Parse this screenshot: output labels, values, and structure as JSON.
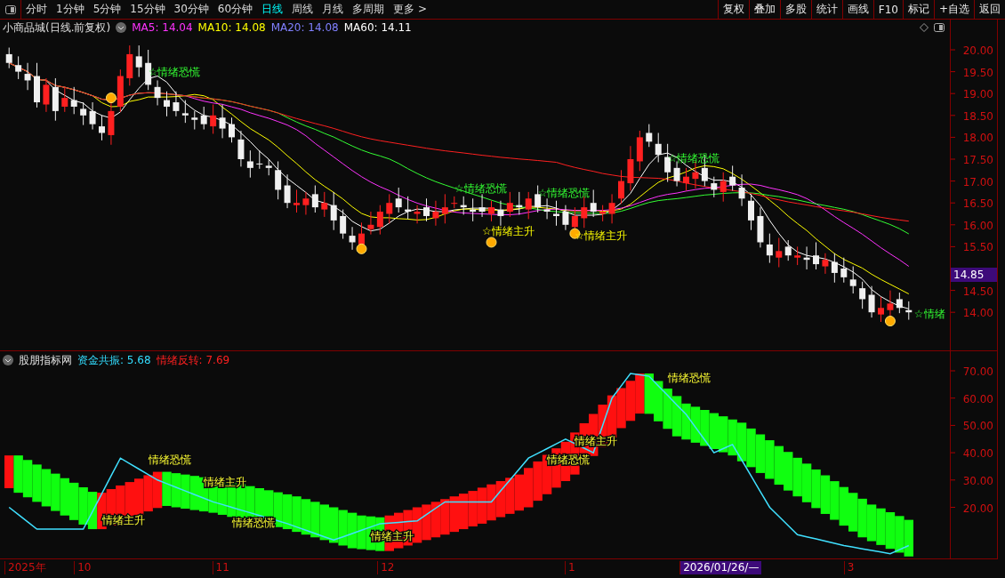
{
  "toolbar": {
    "periods": [
      {
        "label": "分时",
        "selected": false
      },
      {
        "label": "1分钟",
        "selected": false
      },
      {
        "label": "5分钟",
        "selected": false
      },
      {
        "label": "15分钟",
        "selected": false
      },
      {
        "label": "30分钟",
        "selected": false
      },
      {
        "label": "60分钟",
        "selected": false
      },
      {
        "label": "日线",
        "selected": true
      },
      {
        "label": "周线",
        "selected": false
      },
      {
        "label": "月线",
        "selected": false
      },
      {
        "label": "多周期",
        "selected": false
      },
      {
        "label": "更多 >",
        "selected": false
      }
    ],
    "buttons": [
      "复权",
      "叠加",
      "多股",
      "统计",
      "画线",
      "F10",
      "标记",
      "+自选",
      "返回"
    ]
  },
  "price_pane": {
    "title": "小商品城(日线.前复权)",
    "indicators": [
      {
        "text": "MA5: 14.04",
        "color": "#ff33ff"
      },
      {
        "text": "MA10: 14.08",
        "color": "#ffff00"
      },
      {
        "text": "MA20: 14.08",
        "color": "#8080ff"
      },
      {
        "text": "MA60: 14.11",
        "color": "#ffffff"
      }
    ],
    "axis_ticks": [
      "20.00",
      "19.50",
      "19.00",
      "18.50",
      "18.00",
      "17.50",
      "17.00",
      "16.50",
      "16.00",
      "15.50",
      "14.50",
      "14.00"
    ],
    "current_price": "14.85",
    "markers": [
      {
        "text": "☆情绪恐慌",
        "kind": "panic"
      },
      {
        "text": "☆情绪恐慌",
        "kind": "panic"
      },
      {
        "text": "☆情绪主升",
        "kind": "rise"
      },
      {
        "text": "☆情绪恐慌",
        "kind": "panic"
      },
      {
        "text": "☆情绪主升",
        "kind": "rise"
      },
      {
        "text": "☆情绪恐慌",
        "kind": "panic"
      },
      {
        "text": "☆情绪",
        "kind": "panic"
      }
    ]
  },
  "indicator_pane": {
    "name": "股朋指标网",
    "values": [
      {
        "text": "资金共振: 5.68",
        "color": "#33ddff"
      },
      {
        "text": "情绪反转: 7.69",
        "color": "#ff2020"
      }
    ],
    "axis_ticks": [
      "70.00",
      "60.00",
      "50.00",
      "40.00",
      "30.00",
      "20.00"
    ],
    "labels": [
      "情绪主升",
      "情绪恐慌",
      "情绪主升",
      "情绪恐慌",
      "情绪主升",
      "情绪恐慌",
      "情绪主升",
      "情绪恐慌"
    ]
  },
  "time_axis": [
    {
      "text": "2025年",
      "highlight": false
    },
    {
      "text": "10",
      "highlight": false
    },
    {
      "text": "11",
      "highlight": false
    },
    {
      "text": "12",
      "highlight": false
    },
    {
      "text": "1",
      "highlight": false
    },
    {
      "text": "2026/01/26/—",
      "highlight": true
    },
    {
      "text": "3",
      "highlight": false
    }
  ]
}
